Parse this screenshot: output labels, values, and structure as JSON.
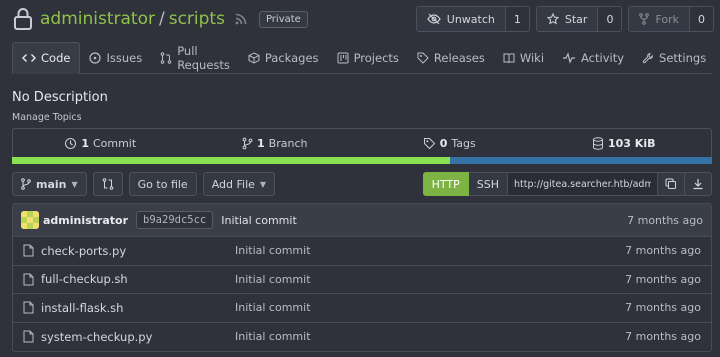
{
  "repo": {
    "owner": "administrator",
    "separator": "/",
    "name": "scripts",
    "visibility": "Private"
  },
  "actions": {
    "unwatch_label": "Unwatch",
    "unwatch_count": "1",
    "star_label": "Star",
    "star_count": "0",
    "fork_label": "Fork",
    "fork_count": "0"
  },
  "tabs": [
    {
      "label": "Code",
      "icon": "code-icon"
    },
    {
      "label": "Issues",
      "icon": "issue-icon"
    },
    {
      "label": "Pull Requests",
      "icon": "pull-request-icon"
    },
    {
      "label": "Packages",
      "icon": "package-icon"
    },
    {
      "label": "Projects",
      "icon": "project-icon"
    },
    {
      "label": "Releases",
      "icon": "tag-icon"
    },
    {
      "label": "Wiki",
      "icon": "book-icon"
    },
    {
      "label": "Activity",
      "icon": "pulse-icon"
    },
    {
      "label": "Settings",
      "icon": "tools-icon"
    }
  ],
  "description": "No Description",
  "manage_topics": "Manage Topics",
  "stats": {
    "commits_count": "1",
    "commits_label": "Commit",
    "branches_count": "1",
    "branches_label": "Branch",
    "tags_count": "0",
    "tags_label": "Tags",
    "size": "103 KiB"
  },
  "language_bar": [
    {
      "fraction": 0.625,
      "color": "#89e051"
    },
    {
      "fraction": 0.375,
      "color": "#3572a5"
    }
  ],
  "toolbar": {
    "branch": "main",
    "goto_file": "Go to file",
    "add_file": "Add File",
    "http": "HTTP",
    "ssh": "SSH",
    "clone_url": "http://gitea.searcher.htb/administrator/scripts.git"
  },
  "latest_commit": {
    "author": "administrator",
    "sha": "b9a29dc5cc",
    "message": "Initial commit",
    "time": "7 months ago"
  },
  "files": [
    {
      "name": "check-ports.py",
      "message": "Initial commit",
      "time": "7 months ago"
    },
    {
      "name": "full-checkup.sh",
      "message": "Initial commit",
      "time": "7 months ago"
    },
    {
      "name": "install-flask.sh",
      "message": "Initial commit",
      "time": "7 months ago"
    },
    {
      "name": "system-checkup.py",
      "message": "Initial commit",
      "time": "7 months ago"
    }
  ],
  "colors": {
    "accent_green": "#7db342",
    "repo_link": "#8fc24a",
    "background": "#2f323b"
  }
}
